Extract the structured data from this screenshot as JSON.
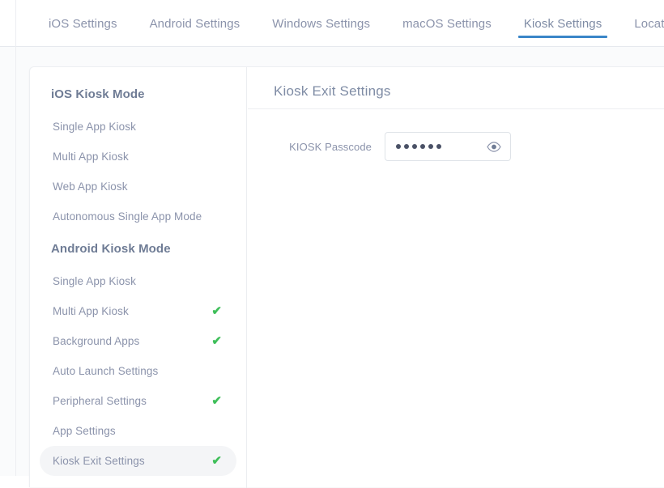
{
  "tabs": [
    {
      "label": "iOS Settings",
      "active": false
    },
    {
      "label": "Android Settings",
      "active": false
    },
    {
      "label": "Windows Settings",
      "active": false
    },
    {
      "label": "macOS Settings",
      "active": false
    },
    {
      "label": "Kiosk Settings",
      "active": true
    },
    {
      "label": "Location Settings",
      "active": false
    }
  ],
  "sidebar": {
    "sections": [
      {
        "title": "iOS Kiosk Mode",
        "items": [
          {
            "label": "Single App Kiosk",
            "checked": false,
            "selected": false
          },
          {
            "label": "Multi App Kiosk",
            "checked": false,
            "selected": false
          },
          {
            "label": "Web App Kiosk",
            "checked": false,
            "selected": false
          },
          {
            "label": "Autonomous Single App Mode",
            "checked": false,
            "selected": false
          }
        ]
      },
      {
        "title": "Android Kiosk Mode",
        "items": [
          {
            "label": "Single App Kiosk",
            "checked": false,
            "selected": false
          },
          {
            "label": "Multi App Kiosk",
            "checked": true,
            "selected": false
          },
          {
            "label": "Background Apps",
            "checked": true,
            "selected": false
          },
          {
            "label": "Auto Launch Settings",
            "checked": false,
            "selected": false
          },
          {
            "label": "Peripheral Settings",
            "checked": true,
            "selected": false
          },
          {
            "label": "App Settings",
            "checked": false,
            "selected": false
          },
          {
            "label": "Kiosk Exit Settings",
            "checked": true,
            "selected": true
          }
        ]
      }
    ],
    "check_glyph": "✔"
  },
  "content": {
    "title": "Kiosk Exit Settings",
    "passcode_label": "KIOSK Passcode",
    "passcode_masked": "••••••",
    "passcode_dot_count": 6,
    "reveal_icon": "eye-icon"
  },
  "colors": {
    "accent_blue": "#3a86c8",
    "check_green": "#3fbf5a",
    "text_muted": "#8b93ab",
    "heading": "#6f7c95",
    "page_bg": "#fafbfc",
    "selected_pill": "#f4f5f7"
  }
}
